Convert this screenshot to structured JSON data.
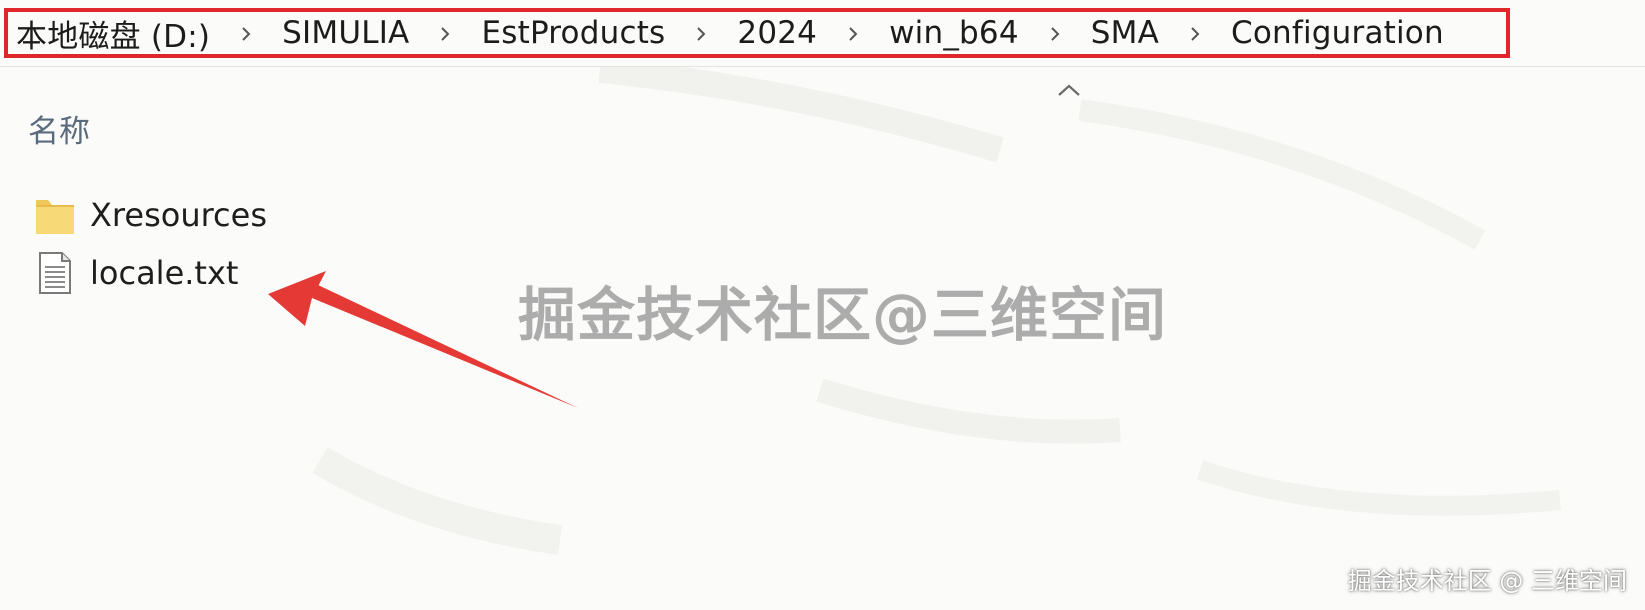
{
  "breadcrumb": {
    "items": [
      {
        "label": "本地磁盘 (D:)"
      },
      {
        "label": "SIMULIA"
      },
      {
        "label": "EstProducts"
      },
      {
        "label": "2024"
      },
      {
        "label": "win_b64"
      },
      {
        "label": "SMA"
      },
      {
        "label": "Configuration"
      }
    ],
    "separator_icon": "chevron-right-icon",
    "highlight_color": "#e0252b"
  },
  "file_list": {
    "column_header": "名称",
    "sort_icon": "chevron-up-icon",
    "items": [
      {
        "name": "Xresources",
        "icon": "folder-icon"
      },
      {
        "name": "locale.txt",
        "icon": "text-file-icon"
      }
    ]
  },
  "annotation": {
    "arrow_icon": "red-arrow-icon",
    "color": "#e53935"
  },
  "watermarks": {
    "center": "掘金技术社区@三维空间",
    "corner": "掘金技术社区 @ 三维空间"
  }
}
